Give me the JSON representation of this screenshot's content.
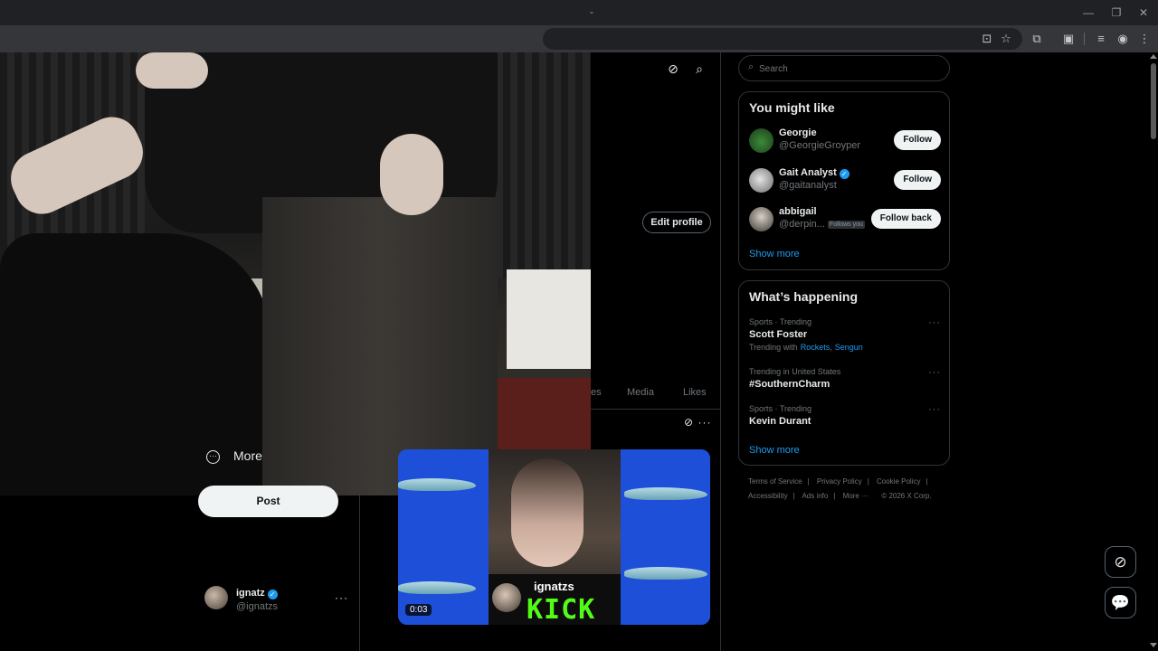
{
  "browser": {
    "window_controls": {
      "minimize": "—",
      "restore": "❐",
      "close": "✕"
    },
    "toolbar_icons": [
      "install-icon",
      "star-icon",
      "extensions-icon",
      "sidebar-icon",
      "media-icon",
      "profile-icon",
      "menu-icon"
    ]
  },
  "profile": {
    "edit_profile": "Edit profile",
    "tabs": [
      "es",
      "Media",
      "Likes"
    ]
  },
  "nav": {
    "more": "More",
    "post": "Post"
  },
  "account": {
    "name": "ignatz",
    "handle": "@ignatzs",
    "verified_mark": "✓"
  },
  "video": {
    "streamer": "ignatzs",
    "platform": "KICK",
    "duration": "0:03"
  },
  "sidebar": {
    "search_placeholder": "Search",
    "you_might_like": {
      "title": "You might like",
      "users": [
        {
          "name": "Georgie",
          "handle": "@GeorgieGroyper",
          "button": "Follow",
          "verified": false
        },
        {
          "name": "Gait Analyst",
          "handle": "@gaitanalyst",
          "button": "Follow",
          "verified": true
        },
        {
          "name": "abbigail",
          "handle": "@derpin...",
          "button": "Follow back",
          "follows_you": "Follows you"
        }
      ],
      "show_more": "Show more"
    },
    "whats_happening": {
      "title": "What’s happening",
      "trends": [
        {
          "meta": "Sports · Trending",
          "title": "Scott Foster",
          "sub_prefix": "Trending with",
          "links": [
            "Rockets",
            "Sengun"
          ]
        },
        {
          "meta": "Trending in United States",
          "title": "#SouthernCharm"
        },
        {
          "meta": "Sports · Trending",
          "title": "Kevin Durant"
        }
      ],
      "show_more": "Show more"
    },
    "footer": {
      "links": [
        "Terms of Service",
        "Privacy Policy",
        "Cookie Policy",
        "Accessibility",
        "Ads info",
        "More ···"
      ],
      "copyright": "© 2026 X Corp."
    }
  },
  "colors": {
    "accent": "#1d9bf0",
    "kick_green": "#53fc18",
    "background": "#000000",
    "border": "#2f3336"
  }
}
